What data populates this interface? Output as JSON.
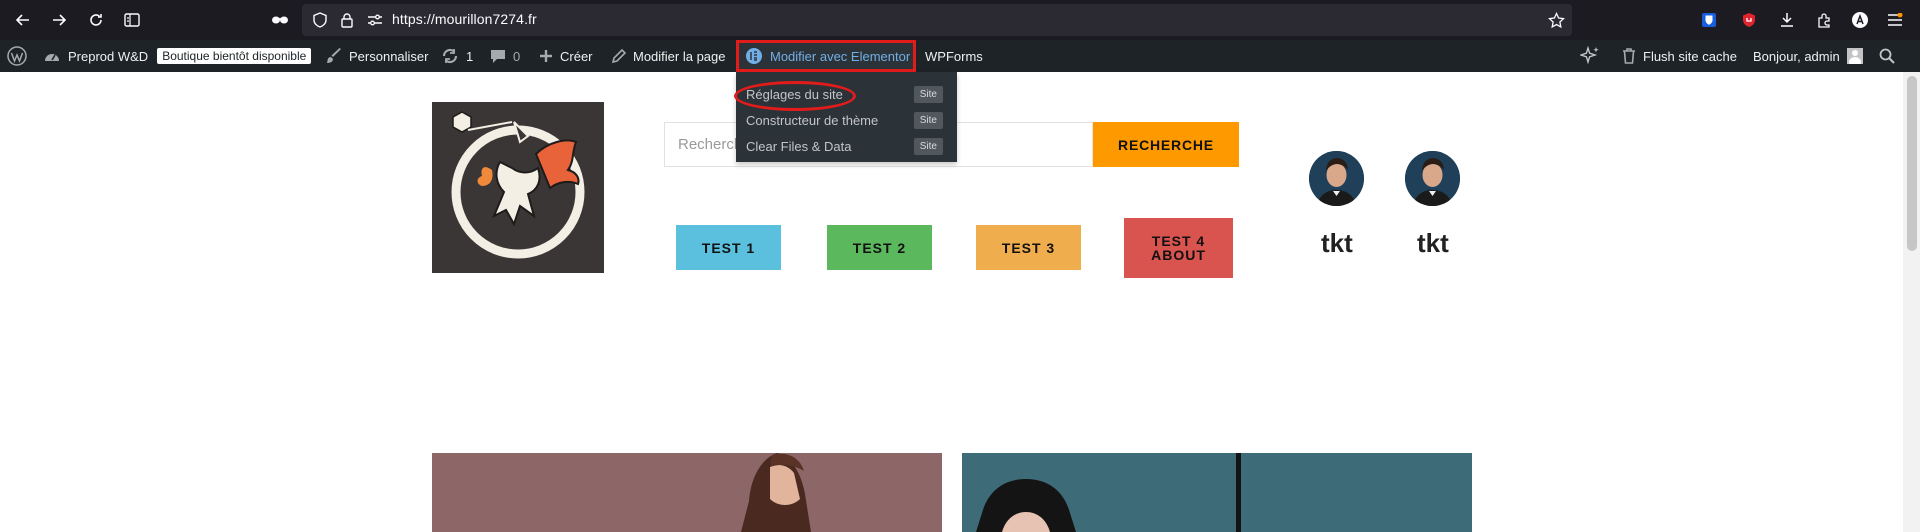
{
  "browser": {
    "url": "https://mourillon7274.fr",
    "icons": [
      "back-icon",
      "forward-icon",
      "reload-icon",
      "reader-icon",
      "incognito-icon",
      "shield-icon",
      "lock-icon",
      "permissions-icon",
      "bookmark-star-icon",
      "bitwarden-icon",
      "ublock-icon",
      "download-icon",
      "extensions-icon",
      "account-icon",
      "menu-icon"
    ]
  },
  "wp_admin": {
    "site_name": "Preprod W&D",
    "badge": "Boutique bientôt disponible",
    "customize": "Personnaliser",
    "updates_count": "1",
    "comments_count": "0",
    "create": "Créer",
    "edit_page": "Modifier la page",
    "elementor": "Modifier avec Elementor",
    "wpforms": "WPForms",
    "flush_cache": "Flush site cache",
    "greeting": "Bonjour, admin"
  },
  "elementor_menu": [
    {
      "label": "Réglages du site",
      "tag": "Site"
    },
    {
      "label": "Constructeur de thème",
      "tag": "Site"
    },
    {
      "label": "Clear Files & Data",
      "tag": "Site"
    }
  ],
  "header": {
    "search_placeholder": "Recherche",
    "search_button": "RECHERCHE",
    "nav_buttons": [
      {
        "label": "TEST 1",
        "color": "#5bc0de"
      },
      {
        "label": "TEST 2",
        "color": "#5cb85c"
      },
      {
        "label": "TEST 3",
        "color": "#f0ad4e"
      },
      {
        "label": "TEST 4 ABOUT",
        "color": "#d9534f"
      }
    ],
    "profiles": [
      {
        "name": "tkt"
      },
      {
        "name": "tkt"
      }
    ]
  },
  "colors": {
    "highlight": "#e21b1b",
    "accent": "#ff9900"
  }
}
